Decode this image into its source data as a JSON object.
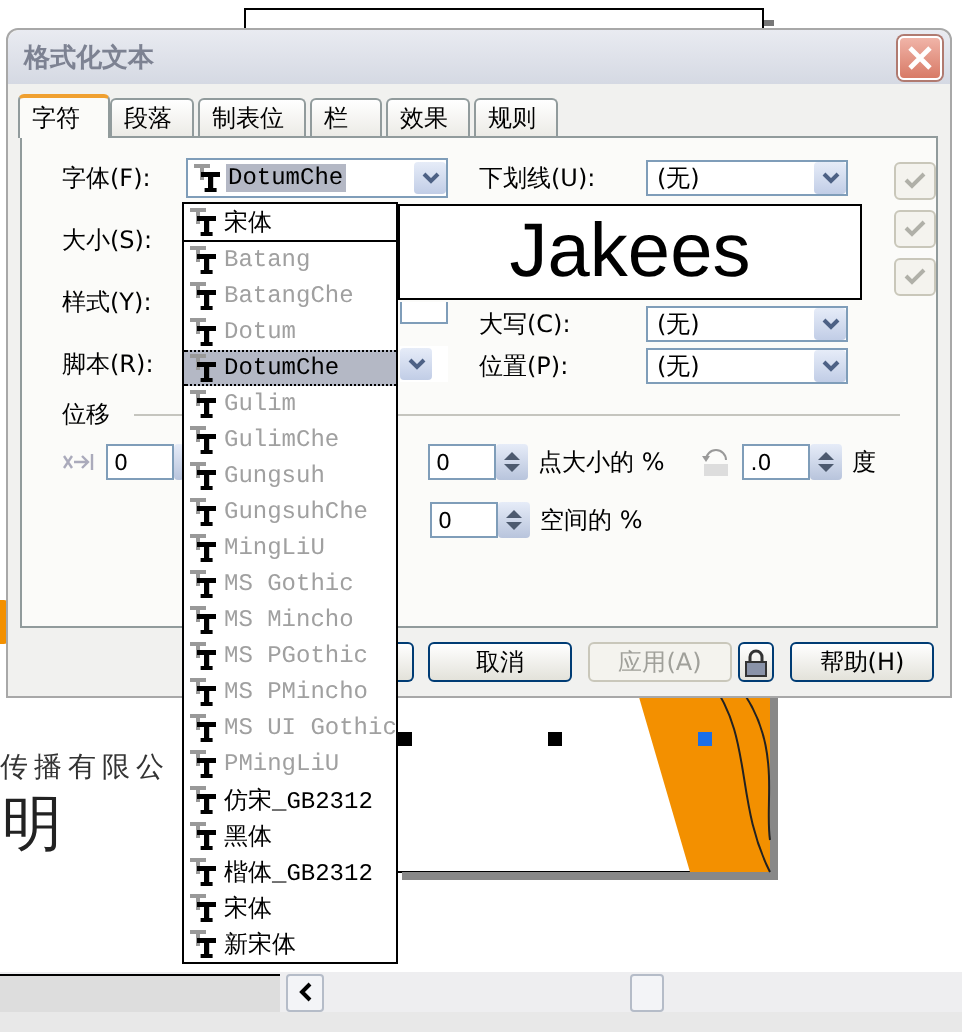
{
  "document": {
    "company_text": "传播有限公",
    "large_text": "明"
  },
  "dialog": {
    "title": "格式化文本",
    "tabs": [
      {
        "label": "字符",
        "selected": true
      },
      {
        "label": "段落",
        "selected": false
      },
      {
        "label": "制表位",
        "selected": false
      },
      {
        "label": "栏",
        "selected": false
      },
      {
        "label": "效果",
        "selected": false
      },
      {
        "label": "规则",
        "selected": false
      }
    ],
    "font": {
      "label": "字体(F):",
      "value": "DotumChe"
    },
    "size": {
      "label": "大小(S):"
    },
    "style": {
      "label": "样式(Y):"
    },
    "script": {
      "label": "脚本(R):"
    },
    "underline": {
      "label": "下划线(U):",
      "value": "(无)"
    },
    "caps": {
      "label": "大写(C):",
      "value": "(无)"
    },
    "position": {
      "label": "位置(P):",
      "value": "(无)"
    },
    "checkboxes": [
      {
        "checked": true,
        "disabled": true
      },
      {
        "checked": true,
        "disabled": true
      },
      {
        "checked": true,
        "disabled": true
      }
    ],
    "offset": {
      "title": "位移",
      "fields": [
        {
          "value": "0"
        },
        {
          "value": "0",
          "unit": "点大小的 %"
        },
        {
          "value": ".0",
          "unit": "度"
        }
      ],
      "spacing": {
        "value": "0",
        "unit": "空间的 %"
      }
    },
    "preview": "Jakees",
    "buttons": [
      {
        "kind": "text",
        "label": "取消",
        "disabled": false
      },
      {
        "kind": "text",
        "label": "应用(A)",
        "disabled": true
      },
      {
        "kind": "lock",
        "disabled": false
      },
      {
        "kind": "text",
        "label": "帮助(H)",
        "disabled": false
      }
    ],
    "font_list": {
      "recent": [
        {
          "label": "宋体",
          "available": true,
          "selected": false
        }
      ],
      "all": [
        {
          "label": "Batang",
          "available": false,
          "selected": false
        },
        {
          "label": "BatangChe",
          "available": false,
          "selected": false
        },
        {
          "label": "Dotum",
          "available": false,
          "selected": false
        },
        {
          "label": "DotumChe",
          "available": true,
          "selected": true
        },
        {
          "label": "Gulim",
          "available": false,
          "selected": false
        },
        {
          "label": "GulimChe",
          "available": false,
          "selected": false
        },
        {
          "label": "Gungsuh",
          "available": false,
          "selected": false
        },
        {
          "label": "GungsuhChe",
          "available": false,
          "selected": false
        },
        {
          "label": "MingLiU",
          "available": false,
          "selected": false
        },
        {
          "label": "MS Gothic",
          "available": false,
          "selected": false
        },
        {
          "label": "MS Mincho",
          "available": false,
          "selected": false
        },
        {
          "label": "MS PGothic",
          "available": false,
          "selected": false
        },
        {
          "label": "MS PMincho",
          "available": false,
          "selected": false
        },
        {
          "label": "MS UI Gothic",
          "available": false,
          "selected": false
        },
        {
          "label": "PMingLiU",
          "available": false,
          "selected": false
        },
        {
          "label": "仿宋_GB2312",
          "available": true,
          "selected": false
        },
        {
          "label": "黑体",
          "available": true,
          "selected": false
        },
        {
          "label": "楷体_GB2312",
          "available": true,
          "selected": false
        },
        {
          "label": "宋体",
          "available": true,
          "selected": false
        },
        {
          "label": "新宋体",
          "available": true,
          "selected": false
        }
      ]
    }
  }
}
